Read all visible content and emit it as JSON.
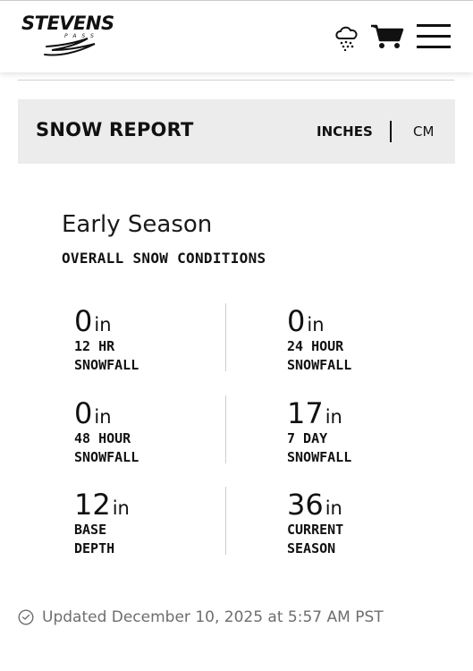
{
  "header": {
    "logo_text": "STEVENS",
    "logo_sub": "PASS",
    "icons": [
      "weather-icon",
      "cart-icon",
      "menu-icon"
    ]
  },
  "report": {
    "title": "SNOW REPORT",
    "unit_inches": "INCHES",
    "unit_cm": "CM",
    "active_unit": "INCHES"
  },
  "conditions": {
    "title": "Early Season",
    "subtitle": "OVERALL SNOW CONDITIONS"
  },
  "stats": [
    {
      "value": "0",
      "unit": "in",
      "label": "12 HR\nSNOWFALL"
    },
    {
      "value": "0",
      "unit": "in",
      "label": "24 HOUR\nSNOWFALL"
    },
    {
      "value": "0",
      "unit": "in",
      "label": "48 HOUR\nSNOWFALL"
    },
    {
      "value": "17",
      "unit": "in",
      "label": "7 DAY\nSNOWFALL"
    },
    {
      "value": "12",
      "unit": "in",
      "label": "BASE\nDEPTH"
    },
    {
      "value": "36",
      "unit": "in",
      "label": "CURRENT\nSEASON"
    }
  ],
  "updated": {
    "text": "Updated December 10, 2025 at 5:57 AM PST"
  },
  "colors": {
    "bar_background": "#ececec",
    "text": "#111111",
    "muted": "#6e6e6e"
  }
}
